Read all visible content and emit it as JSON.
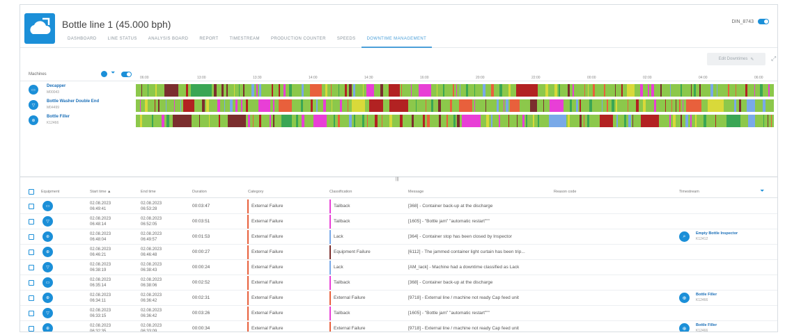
{
  "app": {
    "title": "Bottle line 1 (45.000 bph)",
    "user": "DIN_8743",
    "brand_color": "#1b8fd8"
  },
  "nav_tabs": [
    {
      "label": "Dashboard"
    },
    {
      "label": "Line status"
    },
    {
      "label": "Analysis board"
    },
    {
      "label": "Report"
    },
    {
      "label": "Timestream"
    },
    {
      "label": "Production counter"
    },
    {
      "label": "Speeds"
    },
    {
      "label": "Downtime management"
    }
  ],
  "active_tab": "Downtime management",
  "toolbar": {
    "edit_label": "Edit Downtimes"
  },
  "gantt": {
    "machines_label": "Machines",
    "time_ticks": [
      "06:00",
      "13:00",
      "13:30",
      "14:00",
      "14:30",
      "16:00",
      "20:00",
      "22:00",
      "00:00",
      "02:00",
      "04:00",
      "06:00"
    ],
    "machines": [
      {
        "name": "Decapper",
        "id": "M00043",
        "icon": "decapper-icon"
      },
      {
        "name": "Bottle Washer Double End",
        "id": "M04499",
        "icon": "washer-icon"
      },
      {
        "name": "Bottle Filler",
        "id": "K12466",
        "icon": "filler-icon"
      }
    ],
    "status_colors": {
      "running": "#8cc84b",
      "tailback": "#e83fd6",
      "lack": "#7b2e2e",
      "external": "#e8603c",
      "equipment": "#b22222",
      "scheduled": "#79a9e8",
      "warning": "#d9d93a",
      "idle": "#3aa655"
    }
  },
  "split_label": "|||",
  "table": {
    "headers": {
      "equipment": "Equipment",
      "start_time": "Start time ▲",
      "end_time": "End time",
      "duration": "Duration",
      "category": "Category",
      "classification": "Classification",
      "message": "Message",
      "reason_code": "Reason code",
      "timestream": "Timestream"
    },
    "rows": [
      {
        "icon": "decapper-icon",
        "start_date": "02.08.2023",
        "start_time": "06:49:41",
        "end_date": "02.08.2023",
        "end_time": "06:53:28",
        "duration": "00:03:47",
        "category": "External Failure",
        "classification": "Tailback",
        "message": "[368] - Container back-up at the discharge",
        "timestream_name": "",
        "timestream_id": ""
      },
      {
        "icon": "washer-icon",
        "start_date": "02.08.2023",
        "start_time": "06:48:14",
        "end_date": "02.08.2023",
        "end_time": "06:52:05",
        "duration": "00:03:51",
        "category": "External Failure",
        "classification": "Tailback",
        "message": "[1605] - \"Bottle jam\" \"automatic restart\"\"\"",
        "timestream_name": "",
        "timestream_id": ""
      },
      {
        "icon": "filler-icon",
        "start_date": "02.08.2023",
        "start_time": "06:48:04",
        "end_date": "02.08.2023",
        "end_time": "06:49:57",
        "duration": "00:01:53",
        "category": "External Failure",
        "classification": "Lack",
        "message": "[364] - Container stop has been closed by Inspector",
        "timestream_name": "Empty Bottle Inspector",
        "timestream_id": "K12412"
      },
      {
        "icon": "filler-icon",
        "start_date": "02.08.2023",
        "start_time": "06:46:21",
        "end_date": "02.08.2023",
        "end_time": "06:46:48",
        "duration": "00:00:27",
        "category": "External Failure",
        "classification": "Equipment Failure",
        "message": "[6112] - The jammed container light curtain has been trip...",
        "timestream_name": "",
        "timestream_id": ""
      },
      {
        "icon": "washer-icon",
        "start_date": "02.08.2023",
        "start_time": "06:38:19",
        "end_date": "02.08.2023",
        "end_time": "06:38:43",
        "duration": "00:00:24",
        "category": "External Failure",
        "classification": "Lack",
        "message": "[AM_lack] - Machine had a downtime classified as Lack",
        "timestream_name": "",
        "timestream_id": ""
      },
      {
        "icon": "decapper-icon",
        "start_date": "02.08.2023",
        "start_time": "06:35:14",
        "end_date": "02.08.2023",
        "end_time": "06:38:06",
        "duration": "00:02:52",
        "category": "External Failure",
        "classification": "Tailback",
        "message": "[368] - Container back-up at the discharge",
        "timestream_name": "",
        "timestream_id": ""
      },
      {
        "icon": "filler-icon",
        "start_date": "02.08.2023",
        "start_time": "06:34:11",
        "end_date": "02.08.2023",
        "end_time": "06:36:42",
        "duration": "00:02:31",
        "category": "External Failure",
        "classification": "External Failure",
        "message": "[9718] - External line / machine not ready Cap feed unit",
        "timestream_name": "Bottle Filler",
        "timestream_id": "K12466"
      },
      {
        "icon": "washer-icon",
        "start_date": "02.08.2023",
        "start_time": "06:33:15",
        "end_date": "02.08.2023",
        "end_time": "06:36:42",
        "duration": "00:03:26",
        "category": "External Failure",
        "classification": "Tailback",
        "message": "[1605] - \"Bottle jam\" \"automatic restart\"\"\"",
        "timestream_name": "",
        "timestream_id": ""
      },
      {
        "icon": "filler-icon",
        "start_date": "02.08.2023",
        "start_time": "06:32:35",
        "end_date": "02.08.2023",
        "end_time": "06:33:09",
        "duration": "00:00:34",
        "category": "External Failure",
        "classification": "External Failure",
        "message": "[9718] - External line / machine not ready Cap feed unit",
        "timestream_name": "Bottle Filler",
        "timestream_id": "K12466"
      }
    ]
  }
}
